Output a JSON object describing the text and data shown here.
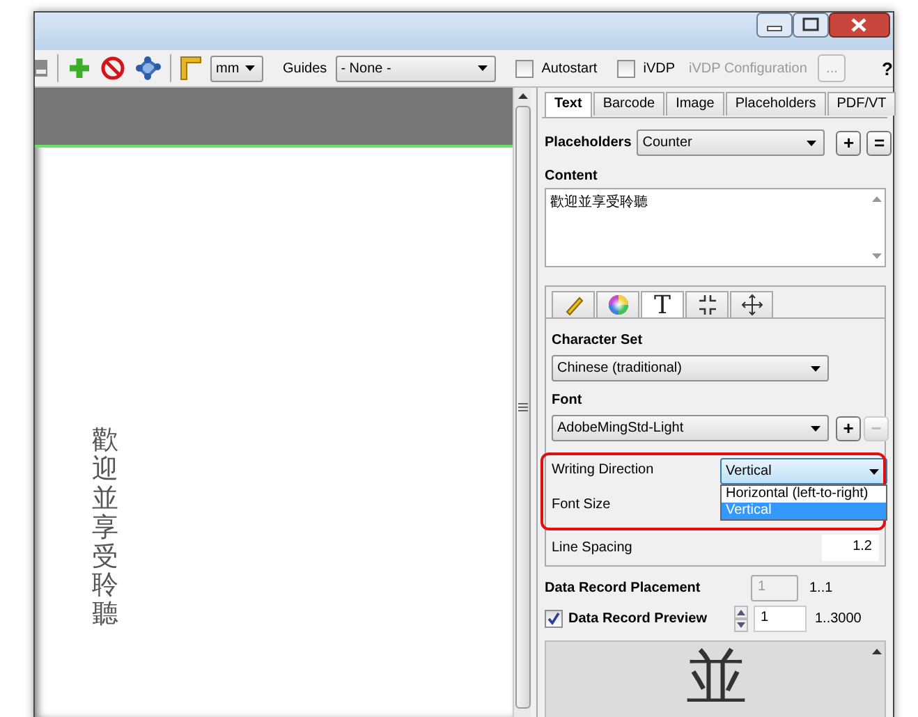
{
  "toolbar": {
    "unit": "mm",
    "guides_label": "Guides",
    "guides": "- None -",
    "autostart": {
      "label": "Autostart",
      "checked": false
    },
    "ivdp": {
      "label": "iVDP",
      "checked": false
    },
    "ivdp_config": {
      "label": "iVDP Configuration",
      "disabled": true
    },
    "more_button": {
      "label": "...",
      "disabled": true
    },
    "help": "?"
  },
  "canvas": {
    "text": "歡迎並享受聆聽"
  },
  "panel": {
    "tabs": [
      {
        "label": "Text",
        "selected": true
      },
      {
        "label": "Barcode",
        "selected": false
      },
      {
        "label": "Image",
        "selected": false
      },
      {
        "label": "Placeholders",
        "selected": false
      },
      {
        "label": "PDF/VT",
        "selected": false
      }
    ],
    "placeholders": {
      "label": "Placeholders",
      "value": "Counter",
      "add": "+",
      "equal": "="
    },
    "content": {
      "label": "Content",
      "value": "歡迎並享受聆聽"
    },
    "icon_tabs": [
      {
        "kind": "ruler",
        "selected": false
      },
      {
        "kind": "color",
        "selected": false
      },
      {
        "kind": "text",
        "glyph": "T",
        "selected": true
      },
      {
        "kind": "shrink",
        "selected": false
      },
      {
        "kind": "move",
        "selected": false
      }
    ],
    "character_set": {
      "label": "Character Set",
      "value": "Chinese (traditional)"
    },
    "font": {
      "label": "Font",
      "value": "AdobeMingStd-Light",
      "add": "+",
      "remove": "−",
      "remove_disabled": true
    },
    "writing_direction": {
      "label": "Writing Direction",
      "value": "Vertical",
      "expanded": true,
      "options": [
        {
          "label": "Horizontal (left-to-right)",
          "selected": false
        },
        {
          "label": "Vertical",
          "selected": true
        }
      ]
    },
    "font_size": {
      "label": "Font Size"
    },
    "line_spacing": {
      "label": "Line Spacing",
      "value": "1.2"
    },
    "data_record_placement": {
      "label": "Data Record Placement",
      "value": "1",
      "range": "1..1",
      "disabled": true
    },
    "data_record_preview": {
      "label": "Data Record Preview",
      "checked": true,
      "value": "1",
      "range": "1..3000"
    },
    "preview": {
      "glyph": "並"
    }
  }
}
